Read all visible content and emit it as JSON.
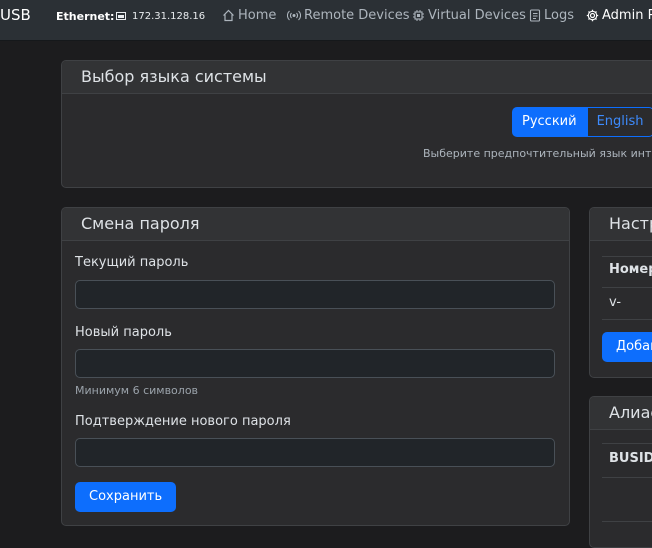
{
  "navbar": {
    "brand": "USB",
    "ethernet_label": "Ethernet:",
    "ethernet_ip": "172.31.128.16",
    "links": [
      {
        "label": "Home",
        "icon": "home-icon"
      },
      {
        "label": "Remote Devices",
        "icon": "broadcast-icon"
      },
      {
        "label": "Virtual Devices",
        "icon": "cpu-icon"
      },
      {
        "label": "Logs",
        "icon": "document-icon"
      },
      {
        "label": "Admin P",
        "icon": "gear-icon"
      }
    ]
  },
  "language_card": {
    "title": "Выбор языка системы",
    "options": [
      "Русский",
      "English"
    ],
    "selected": "Русский",
    "hint": "Выберите предпочтительный язык интер"
  },
  "password_card": {
    "title": "Смена пароля",
    "current_label": "Текущий пароль",
    "current_value": "",
    "new_label": "Новый пароль",
    "new_value": "",
    "new_help": "Минимум 6 символов",
    "confirm_label": "Подтверждение нового пароля",
    "confirm_value": "",
    "save_label": "Сохранить"
  },
  "settings_card": {
    "title": "Настр",
    "column_header": "Номер",
    "row_value": "v-",
    "add_label": "Добав"
  },
  "alias_card": {
    "title": "Алиас",
    "column_header": "BUSID"
  },
  "colors": {
    "accent": "#0d6efd",
    "navbar_bg": "#2b3035",
    "page_bg": "#1c1c1e",
    "card_bg": "#2b2b2d"
  }
}
